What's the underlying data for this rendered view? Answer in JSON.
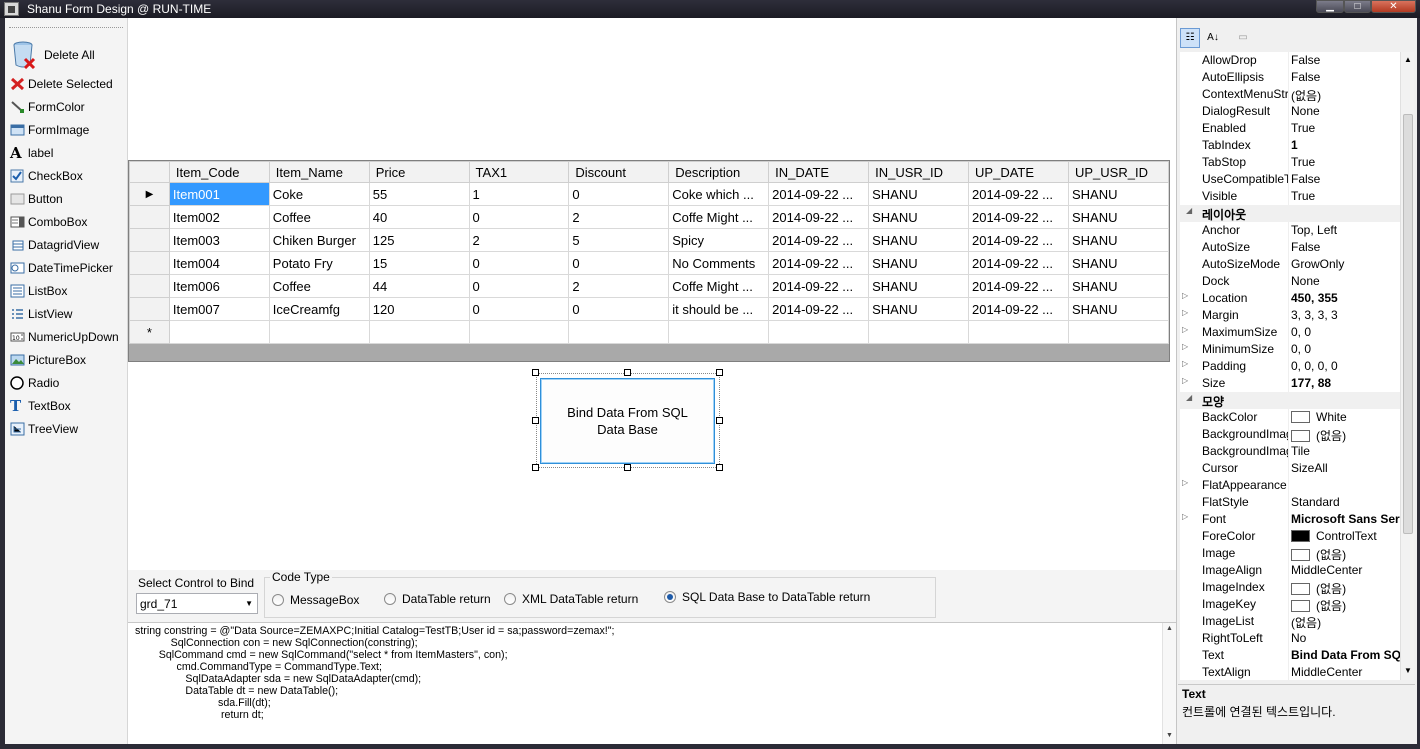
{
  "window": {
    "title": "Shanu Form Design @ RUN-TIME",
    "min_glyph": "▁",
    "max_glyph": "□",
    "close_glyph": "✕"
  },
  "toolbox": {
    "items": [
      {
        "label": "Delete All",
        "icon": "trash-icon"
      },
      {
        "label": "Delete Selected",
        "icon": "red-x-icon"
      },
      {
        "label": "FormColor",
        "icon": "paint-brush-icon"
      },
      {
        "label": "FormImage",
        "icon": "image-form-icon"
      },
      {
        "label": "label",
        "icon": "label-a-icon",
        "glyph": "A"
      },
      {
        "label": "CheckBox",
        "icon": "checkbox-icon"
      },
      {
        "label": "Button",
        "icon": "button-icon"
      },
      {
        "label": "ComboBox",
        "icon": "combobox-icon"
      },
      {
        "label": "DatagridView",
        "icon": "datagrid-icon"
      },
      {
        "label": "DateTimePicker",
        "icon": "datetimepicker-icon"
      },
      {
        "label": "ListBox",
        "icon": "listbox-icon"
      },
      {
        "label": "ListView",
        "icon": "listview-icon"
      },
      {
        "label": "NumericUpDown",
        "icon": "numericupdown-icon"
      },
      {
        "label": "PictureBox",
        "icon": "picturebox-icon"
      },
      {
        "label": "Radio",
        "icon": "radio-icon"
      },
      {
        "label": "TextBox",
        "icon": "textbox-icon",
        "glyph": "T"
      },
      {
        "label": "TreeView",
        "icon": "treeview-icon"
      }
    ]
  },
  "grid": {
    "columns": [
      "Item_Code",
      "Item_Name",
      "Price",
      "TAX1",
      "Discount",
      "Description",
      "IN_DATE",
      "IN_USR_ID",
      "UP_DATE",
      "UP_USR_ID"
    ],
    "rows": [
      [
        "Item001",
        "Coke",
        "55",
        "1",
        "0",
        "Coke which ...",
        "2014-09-22 ...",
        "SHANU",
        "2014-09-22 ...",
        "SHANU"
      ],
      [
        "Item002",
        "Coffee",
        "40",
        "0",
        "2",
        "Coffe Might ...",
        "2014-09-22 ...",
        "SHANU",
        "2014-09-22 ...",
        "SHANU"
      ],
      [
        "Item003",
        "Chiken Burger",
        "125",
        "2",
        "5",
        "Spicy",
        "2014-09-22 ...",
        "SHANU",
        "2014-09-22 ...",
        "SHANU"
      ],
      [
        "Item004",
        "Potato Fry",
        "15",
        "0",
        "0",
        "No Comments",
        "2014-09-22 ...",
        "SHANU",
        "2014-09-22 ...",
        "SHANU"
      ],
      [
        "Item006",
        "Coffee",
        "44",
        "0",
        "2",
        "Coffe Might ...",
        "2014-09-22 ...",
        "SHANU",
        "2014-09-22 ...",
        "SHANU"
      ],
      [
        "Item007",
        "IceCreamfg",
        "120",
        "0",
        "0",
        "it should be ...",
        "2014-09-22 ...",
        "SHANU",
        "2014-09-22 ...",
        "SHANU"
      ]
    ],
    "current_row_glyph": "▶",
    "new_row_glyph": "*"
  },
  "bind_button": {
    "label": "Bind Data From  SQL Data Base"
  },
  "bottom": {
    "select_label": "Select Control to Bind",
    "select_value": "grd_71",
    "code_type_legend": "Code Type",
    "radios": [
      {
        "label": "MessageBox",
        "checked": false
      },
      {
        "label": "DataTable return",
        "checked": false
      },
      {
        "label": "XML DataTable return",
        "checked": false
      },
      {
        "label": "SQL Data Base to DataTable return",
        "checked": true
      }
    ],
    "code": "string constring = @\"Data Source=ZEMAXPC;Initial Catalog=TestTB;User id = sa;password=zemax!\";\n            SqlConnection con = new SqlConnection(constring);\n        SqlCommand cmd = new SqlCommand(\"select * from ItemMasters\", con);\n              cmd.CommandType = CommandType.Text;\n                 SqlDataAdapter sda = new SqlDataAdapter(cmd);\n                 DataTable dt = new DataTable();\n                            sda.Fill(dt);\n                             return dt;"
  },
  "propgrid": {
    "toolbar": {
      "categorized": "☷",
      "alphabetical": "A↓",
      "pages": "▭"
    },
    "rows": [
      {
        "name": "AllowDrop",
        "value": "False"
      },
      {
        "name": "AutoEllipsis",
        "value": "False"
      },
      {
        "name": "ContextMenuStrip",
        "value": "(없음)"
      },
      {
        "name": "DialogResult",
        "value": "None"
      },
      {
        "name": "Enabled",
        "value": "True"
      },
      {
        "name": "TabIndex",
        "value": "1",
        "bold": true
      },
      {
        "name": "TabStop",
        "value": "True"
      },
      {
        "name": "UseCompatibleTextRendering",
        "value": "False"
      },
      {
        "name": "Visible",
        "value": "True"
      },
      {
        "name": "레이아웃",
        "category": true
      },
      {
        "name": "Anchor",
        "value": "Top, Left"
      },
      {
        "name": "AutoSize",
        "value": "False"
      },
      {
        "name": "AutoSizeMode",
        "value": "GrowOnly"
      },
      {
        "name": "Dock",
        "value": "None"
      },
      {
        "name": "Location",
        "value": "450, 355",
        "bold": true,
        "expand": true
      },
      {
        "name": "Margin",
        "value": "3, 3, 3, 3",
        "expand": true
      },
      {
        "name": "MaximumSize",
        "value": "0, 0",
        "expand": true
      },
      {
        "name": "MinimumSize",
        "value": "0, 0",
        "expand": true
      },
      {
        "name": "Padding",
        "value": "0, 0, 0, 0",
        "expand": true
      },
      {
        "name": "Size",
        "value": "177, 88",
        "bold": true,
        "expand": true
      },
      {
        "name": "모양",
        "category": true
      },
      {
        "name": "BackColor",
        "value": "White",
        "swatch": "white"
      },
      {
        "name": "BackgroundImage",
        "value": "(없음)",
        "swatch": "white"
      },
      {
        "name": "BackgroundImageLayout",
        "value": "Tile"
      },
      {
        "name": "Cursor",
        "value": "SizeAll"
      },
      {
        "name": "FlatAppearance",
        "value": "",
        "expand": true
      },
      {
        "name": "FlatStyle",
        "value": "Standard"
      },
      {
        "name": "Font",
        "value": "Microsoft Sans Serif",
        "bold": true,
        "expand": true
      },
      {
        "name": "ForeColor",
        "value": "ControlText",
        "swatch": "black"
      },
      {
        "name": "Image",
        "value": "(없음)",
        "swatch": "white"
      },
      {
        "name": "ImageAlign",
        "value": "MiddleCenter"
      },
      {
        "name": "ImageIndex",
        "value": "(없음)",
        "swatch": "white"
      },
      {
        "name": "ImageKey",
        "value": "(없음)",
        "swatch": "white"
      },
      {
        "name": "ImageList",
        "value": "(없음)"
      },
      {
        "name": "RightToLeft",
        "value": "No"
      },
      {
        "name": "Text",
        "value": "Bind Data From  SQL Data Base",
        "bold": true
      },
      {
        "name": "TextAlign",
        "value": "MiddleCenter"
      }
    ],
    "help_title": "Text",
    "help_desc": "컨트롤에 연결된 텍스트입니다."
  },
  "colors": {
    "selection": "#3399ff",
    "accent_border": "#2f8fd9",
    "titlebar": "#1b1b24"
  }
}
